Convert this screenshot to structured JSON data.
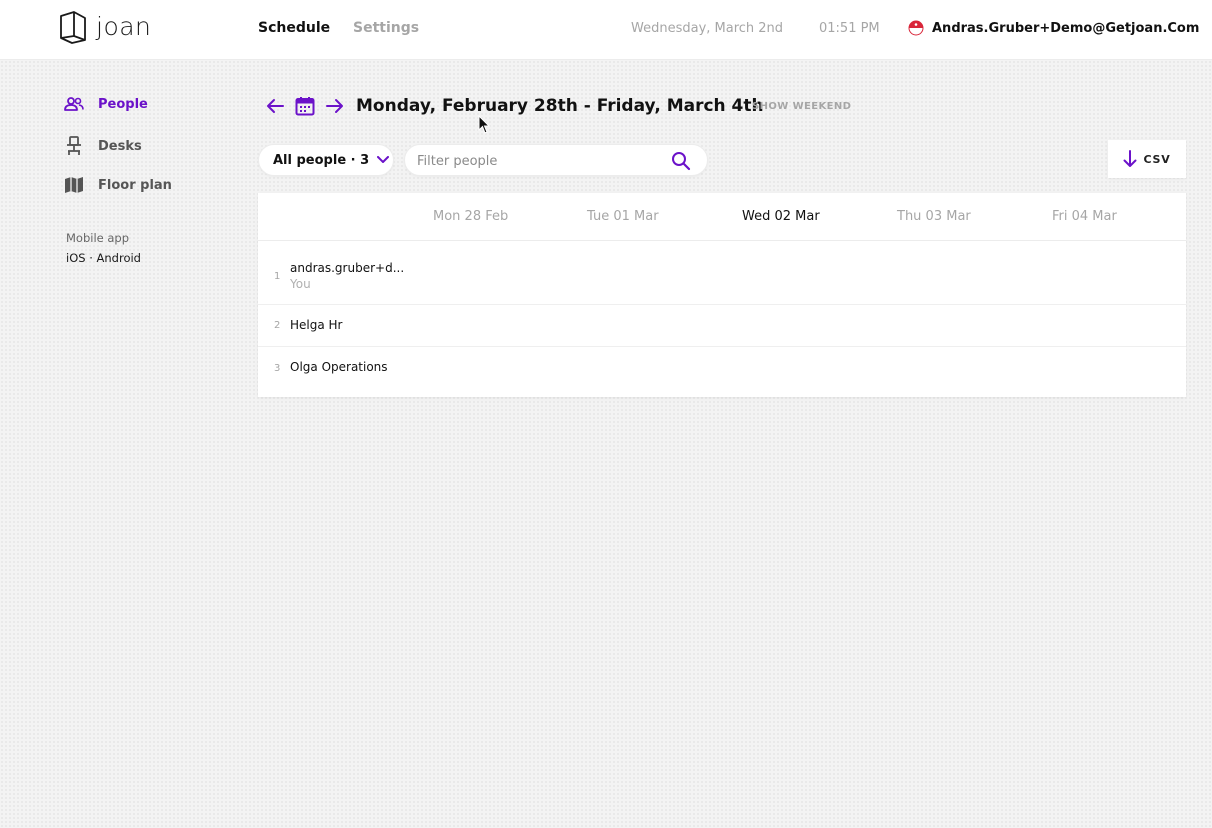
{
  "app": {
    "name": "joan"
  },
  "header": {
    "tabs": [
      {
        "label": "Schedule",
        "active": true
      },
      {
        "label": "Settings",
        "active": false
      }
    ],
    "date": "Wednesday, March 2nd",
    "time": "01:51 PM",
    "user": {
      "name": "Andras.Gruber+Demo@Getjoan.Com",
      "avatar_icon": "flag-avatar-icon"
    }
  },
  "sidebar": {
    "items": [
      {
        "label": "People",
        "icon": "people-icon",
        "active": true
      },
      {
        "label": "Desks",
        "icon": "desk-chair-icon",
        "active": false
      },
      {
        "label": "Floor plan",
        "icon": "map-icon",
        "active": false
      }
    ],
    "mobile_app_label": "Mobile app",
    "mobile_links": "iOS · Android"
  },
  "toolbar": {
    "range_title": "Monday, February 28th - Friday, March 4th",
    "show_weekend": "SHOW WEEKEND",
    "filter_label": "All people · 3",
    "search_placeholder": "Filter people",
    "search_value": "",
    "export_label": "CSV"
  },
  "schedule": {
    "days": [
      {
        "label": "Mon 28 Feb",
        "today": false
      },
      {
        "label": "Tue 01 Mar",
        "today": false
      },
      {
        "label": "Wed 02 Mar",
        "today": true
      },
      {
        "label": "Thu 03 Mar",
        "today": false
      },
      {
        "label": "Fri 04 Mar",
        "today": false
      }
    ],
    "people": [
      {
        "index": "1",
        "name": "andras.gruber+d...",
        "sub": "You"
      },
      {
        "index": "2",
        "name": "Helga Hr",
        "sub": ""
      },
      {
        "index": "3",
        "name": "Olga Operations",
        "sub": ""
      }
    ]
  },
  "colors": {
    "accent": "#6b12c9",
    "muted_text": "#a6a6a6",
    "avatar_red": "#d9263a"
  }
}
